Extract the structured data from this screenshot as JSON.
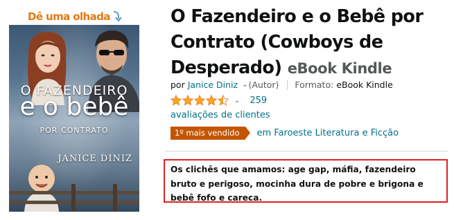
{
  "look_inside": {
    "label": "Dê uma olhada",
    "color": "#e47911"
  },
  "cover": {
    "line1": "O FAZENDEIRO",
    "line2": "e o bebê",
    "line3": "POR CONTRATO",
    "author": "JANICE DINIZ"
  },
  "product": {
    "title": "O Fazendeiro e o Bebê por Contrato (Cowboys de Desperado)",
    "format_suffix": "eBook Kindle",
    "by_label": "por",
    "author": "Janice Diniz",
    "author_role": "(Autor)",
    "format_label": "Formato:",
    "format_value": "eBook Kindle"
  },
  "rating": {
    "stars": 4.5,
    "count": "259",
    "reviews_label": "avaliações de clientes",
    "star_color": "#ffa41c"
  },
  "bestseller": {
    "badge": "1º mais vendido",
    "category": "em Faroeste Literatura e Ficção",
    "badge_color": "#c45500"
  },
  "promo": {
    "text": "Os clichês que amamos: age gap, máfia, fazendeiro bruto e perigoso, mocinha dura de pobre e brigona e bebê fofo e careca.",
    "border_color": "#e0201e"
  }
}
